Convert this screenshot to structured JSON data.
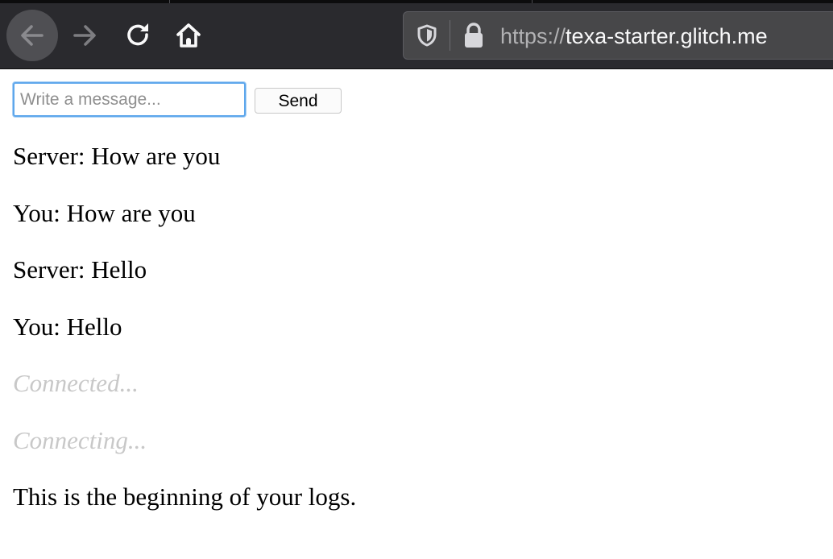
{
  "browser": {
    "url_scheme": "https://",
    "url_host": "texa-starter.glitch.me"
  },
  "composer": {
    "placeholder": "Write a message...",
    "value": "",
    "send_label": "Send"
  },
  "log": [
    {
      "text": "Server: How are you",
      "kind": "message"
    },
    {
      "text": "You: How are you",
      "kind": "message"
    },
    {
      "text": "Server: Hello",
      "kind": "message"
    },
    {
      "text": "You: Hello",
      "kind": "message"
    },
    {
      "text": "Connected...",
      "kind": "status"
    },
    {
      "text": "Connecting...",
      "kind": "status"
    },
    {
      "text": "This is the beginning of your logs.",
      "kind": "message"
    }
  ],
  "icons": {
    "back": "arrow-left-icon",
    "forward": "arrow-right-icon",
    "reload": "reload-icon",
    "home": "home-icon",
    "tracking": "shield-icon",
    "security": "lock-icon"
  },
  "colors": {
    "toolbar": "#2a2a2e",
    "urlbar": "#474749",
    "focus_ring": "#5ea7ec",
    "status_text": "#c8c8c8"
  }
}
